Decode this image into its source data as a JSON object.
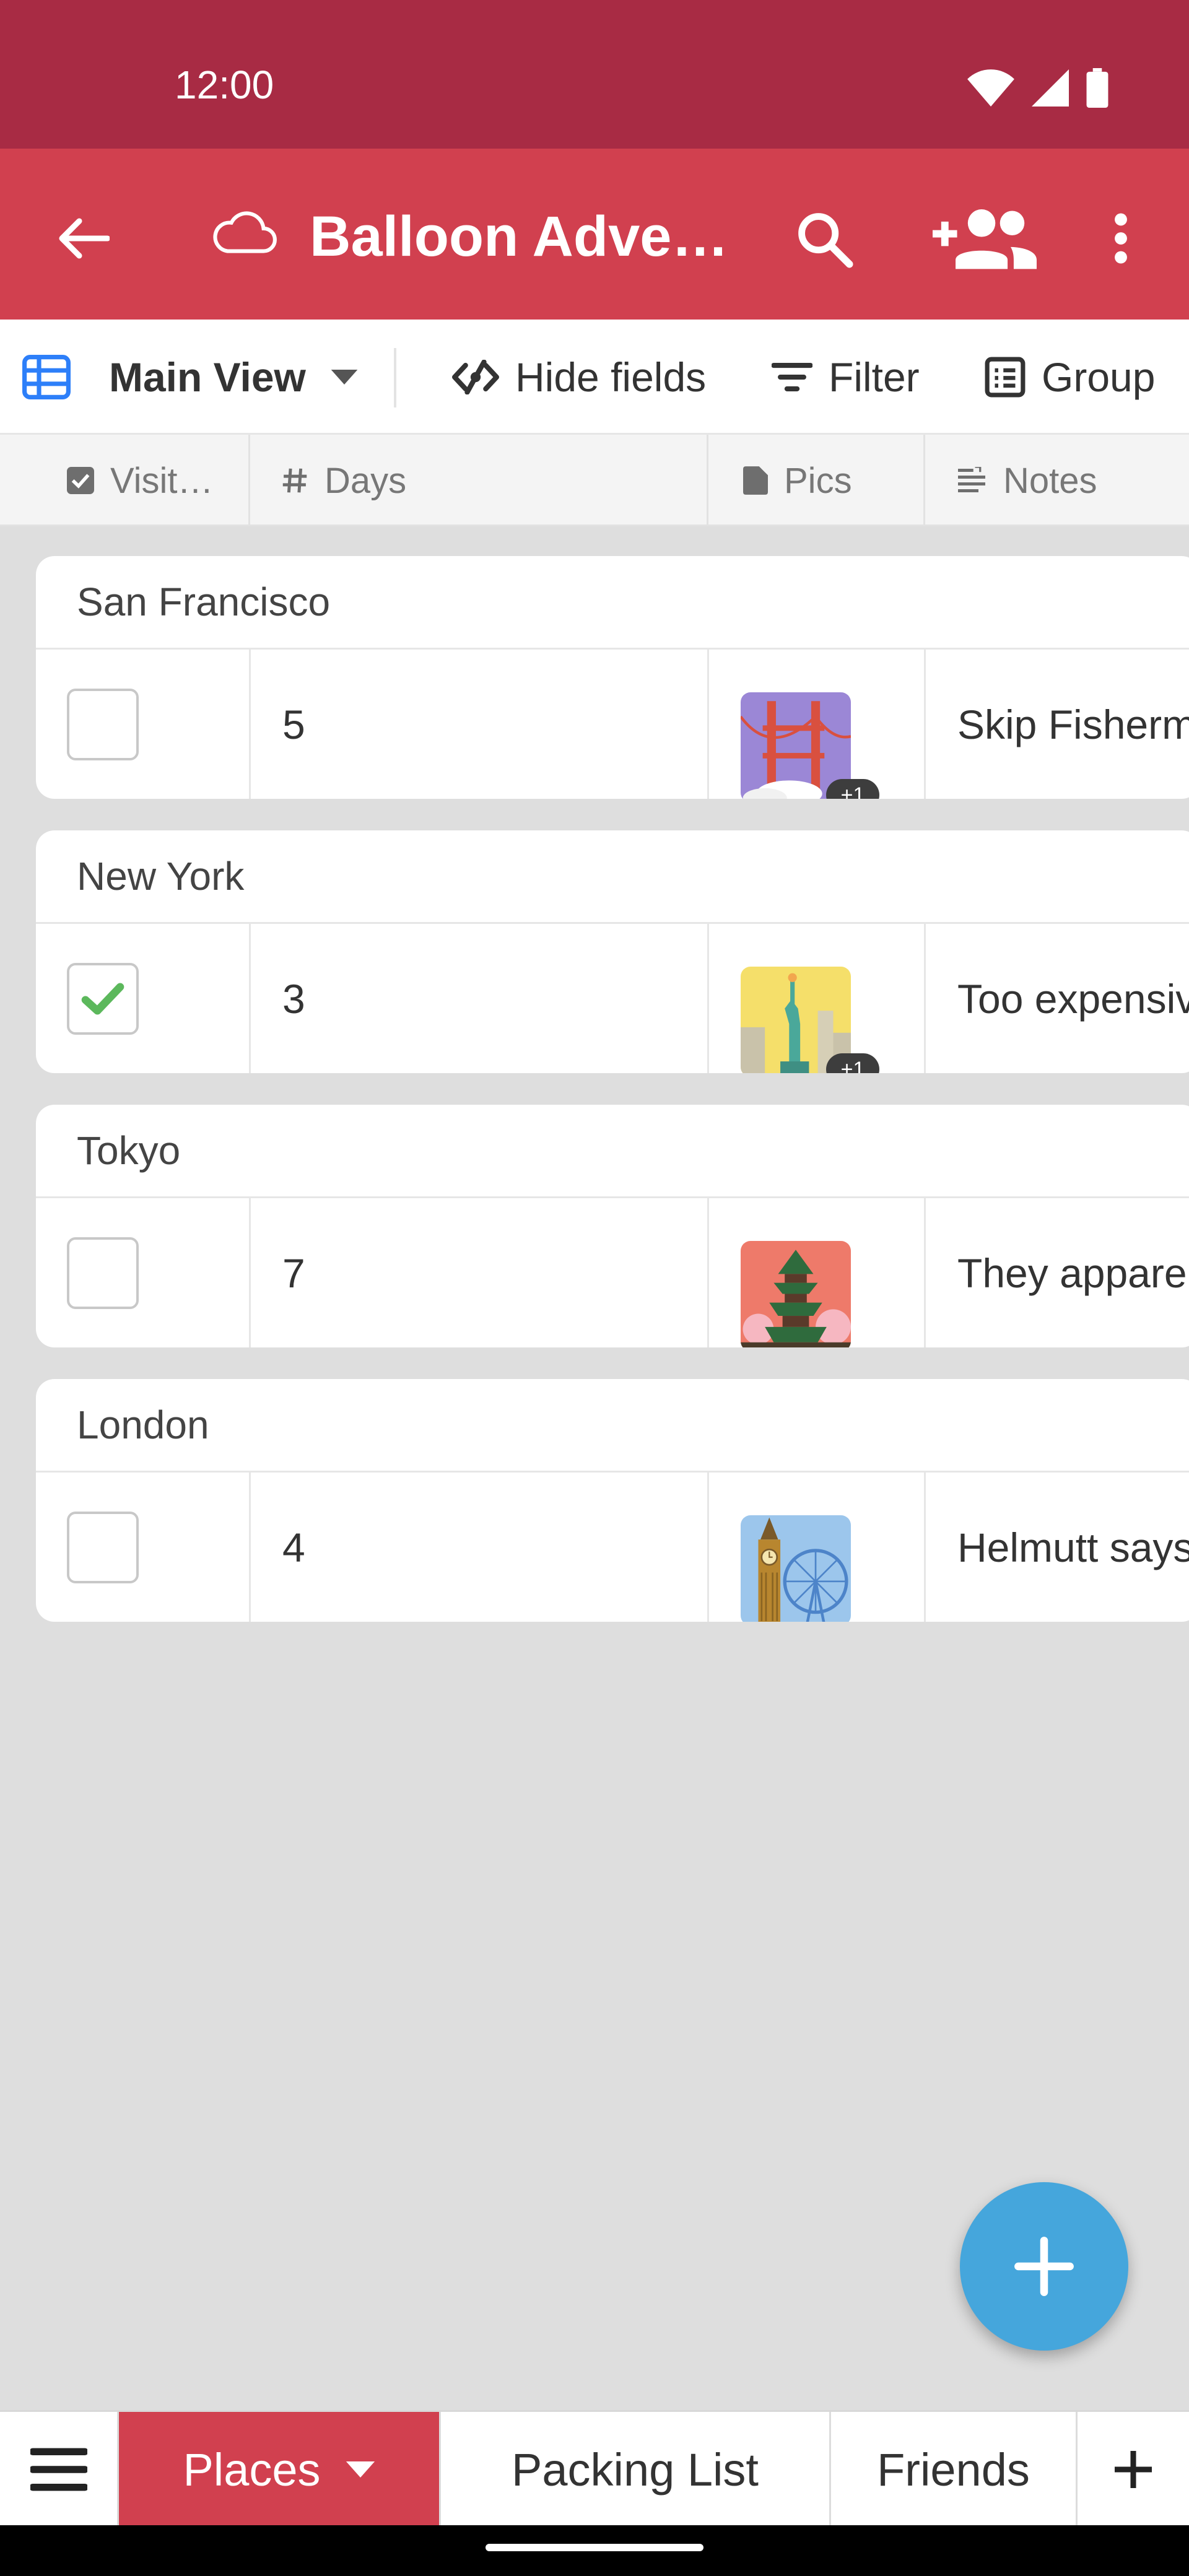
{
  "status_bar": {
    "time": "12:00"
  },
  "app_bar": {
    "title": "Balloon Adve…"
  },
  "toolbar": {
    "view_label": "Main View",
    "hide_fields_label": "Hide fields",
    "filter_label": "Filter",
    "group_label": "Group"
  },
  "columns": {
    "visited": "Visit…",
    "days": "Days",
    "pics": "Pics",
    "notes": "Notes"
  },
  "records": [
    {
      "title": "San Francisco",
      "visited": false,
      "days": "5",
      "pics_extra": "+1",
      "notes": "Skip Fisherm"
    },
    {
      "title": "New York",
      "visited": true,
      "days": "3",
      "pics_extra": "+1",
      "notes": "Too expensiv"
    },
    {
      "title": "Tokyo",
      "visited": false,
      "days": "7",
      "pics_extra": "",
      "notes": "They apparen"
    },
    {
      "title": "London",
      "visited": false,
      "days": "4",
      "pics_extra": "",
      "notes": "Helmutt says"
    }
  ],
  "bottom_tabs": {
    "places": "Places",
    "packing_list": "Packing List",
    "friends": "Friends"
  },
  "colors": {
    "status_bar": "#a82b44",
    "app_bar": "#d1404f",
    "fab": "#45a6dc",
    "check": "#5cb85c"
  }
}
